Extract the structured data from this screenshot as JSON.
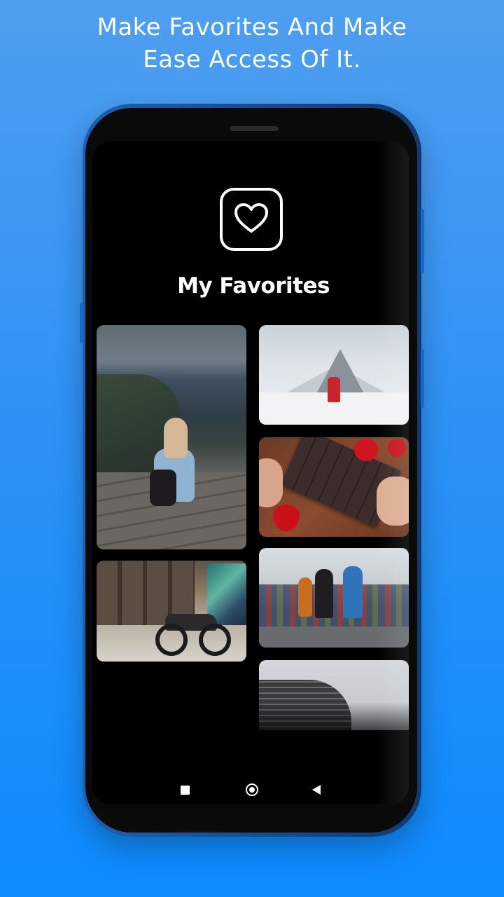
{
  "banner": {
    "line1": "Make Favorites And Make",
    "line2": "Ease Access Of It."
  },
  "app": {
    "title": "My Favorites",
    "icon": "heart-icon"
  },
  "gallery": {
    "items": [
      {
        "subject": "woman sitting on cliff edge overlooking sea"
      },
      {
        "subject": "hiker in red jacket facing snowy mountain peak"
      },
      {
        "subject": "hands holding chocolate bar with strawberries"
      },
      {
        "subject": "motorcycle parked by graffiti wall"
      },
      {
        "subject": "cyclists racing past crowd"
      },
      {
        "subject": "curved glass office tower"
      }
    ]
  },
  "navbar": {
    "icons": [
      "recent-apps-icon",
      "home-icon",
      "back-icon"
    ]
  },
  "colors": {
    "background_top": "#4f9ef0",
    "background_bottom": "#0d8bff",
    "screen": "#000000",
    "text": "#ffffff"
  }
}
